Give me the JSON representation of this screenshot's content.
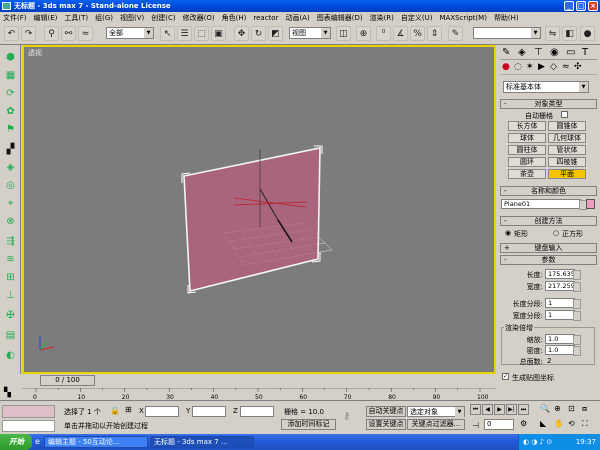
{
  "window": {
    "title": "无标题  - 3ds max 7  - Stand-alone License"
  },
  "menu": [
    "文件(F)",
    "编辑(E)",
    "工具(T)",
    "组(G)",
    "视图(V)",
    "创建(C)",
    "修改器(O)",
    "角色(H)",
    "reactor",
    "动画(A)",
    "图表编辑器(D)",
    "渲染(R)",
    "自定义(U)",
    "MAXScript(M)",
    "帮助(H)"
  ],
  "toolbar": {
    "selection_filter": "全部",
    "ref_coord": "视图",
    "named_sel": ""
  },
  "viewport": {
    "label": "透视"
  },
  "command_panel": {
    "category": "标准基本体",
    "object_type": {
      "header": "对象类型",
      "autogrid": "自动栅格",
      "buttons": [
        "长方体",
        "圆锥体",
        "球体",
        "几何球体",
        "圆柱体",
        "管状体",
        "圆环",
        "四棱锥",
        "茶壶",
        "平面"
      ],
      "selected": "平面"
    },
    "name_color": {
      "header": "名称和颜色",
      "name": "Plane01",
      "color": "#e8a0b8"
    },
    "creation": {
      "header": "创建方法",
      "opt1": "矩形",
      "opt2": "正方形"
    },
    "kbd_entry": {
      "header": "键盘输入"
    },
    "params": {
      "header": "参数",
      "length_label": "长度:",
      "length": "175.635",
      "width_label": "宽度:",
      "width": "217.259",
      "lsegs_label": "长度分段:",
      "lsegs": "1",
      "wsegs_label": "宽度分段:",
      "wsegs": "1",
      "render_mult": "渲染倍增",
      "scale_label": "缩放:",
      "scale": "1.0",
      "density_label": "密度:",
      "density": "1.0",
      "faces_label": "总面数:",
      "faces": "2",
      "gen_mapping": "生成贴图坐标"
    }
  },
  "timeline": {
    "slider": "0 / 100",
    "ticks": [
      "0",
      "10",
      "20",
      "30",
      "40",
      "50",
      "60",
      "70",
      "80",
      "90",
      "100"
    ]
  },
  "status": {
    "selected": "选择了 1 个",
    "x_label": "X",
    "y_label": "Y",
    "z_label": "Z",
    "grid": "栅格 = 10.0",
    "autokey": "自动关键点",
    "setkey": "设置关键点",
    "sel_obj": "选定对象",
    "keyfilter": "关键点过滤器...",
    "prompt": "单击并拖动以开始创建过程",
    "addtime": "添加时间标记",
    "frame": "0"
  },
  "taskbar": {
    "start": "开始",
    "tasks": [
      "编辑主题 - 50互动论...",
      "无标题  - 3ds max 7 ..."
    ],
    "time": "19:37"
  }
}
